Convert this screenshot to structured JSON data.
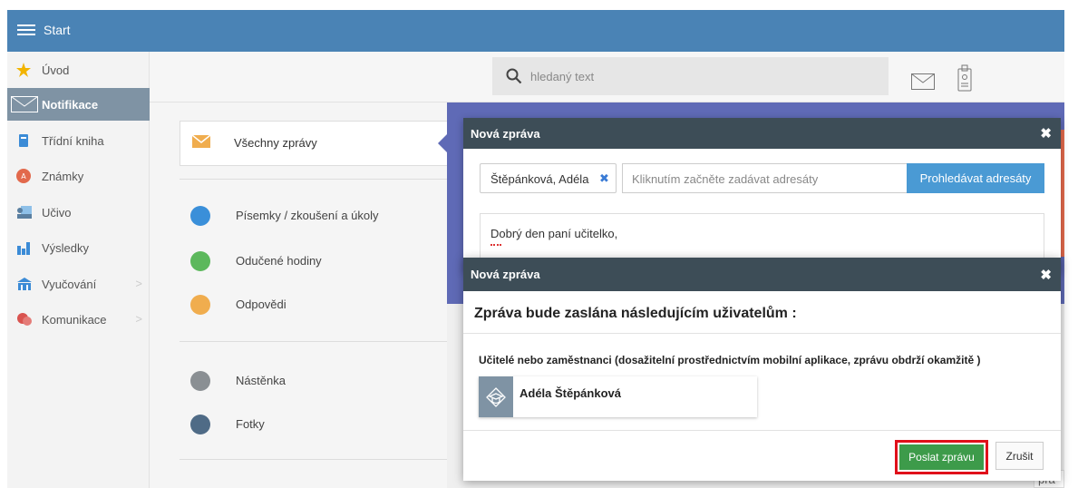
{
  "header": {
    "title": "Start"
  },
  "sidebar": {
    "items": [
      {
        "label": "Úvod",
        "icon": "star-icon",
        "color": "#f2b400"
      },
      {
        "label": "Notifikace",
        "icon": "envelope-icon",
        "color": "#ffffff"
      },
      {
        "label": "Třídní kniha",
        "icon": "book-icon",
        "color": "#3b8bd6"
      },
      {
        "label": "Známky",
        "icon": "grade-icon",
        "color": "#e2694c"
      },
      {
        "label": "Učivo",
        "icon": "teacher-icon",
        "color": "#5aa0d6"
      },
      {
        "label": "Výsledky",
        "icon": "bar-chart-icon",
        "color": "#3b8bd6"
      },
      {
        "label": "Vyučování",
        "icon": "building-icon",
        "color": "#3b8bd6"
      },
      {
        "label": "Komunikace",
        "icon": "chat-icon",
        "color": "#d9534f"
      }
    ]
  },
  "search": {
    "placeholder": "hledaný text"
  },
  "middle": {
    "all_messages": "Všechny zprávy",
    "items": [
      {
        "label": "Písemky / zkoušení a úkoly",
        "color": "#3a8fd9"
      },
      {
        "label": "Odučené hodiny",
        "color": "#5cb85c"
      },
      {
        "label": "Odpovědi",
        "color": "#f0ad4e"
      },
      {
        "label": "Nástěnka",
        "color": "#8a8f93"
      },
      {
        "label": "Fotky",
        "color": "#4f6b86"
      }
    ]
  },
  "modal1": {
    "title": "Nová zpráva",
    "recipient": "Štěpánková, Adéla",
    "recipient_placeholder": "Kliknutím začněte zadávat adresáty",
    "browse_button": "Prohledávat adresáty",
    "body_text": "Dobrý den paní učitelko,"
  },
  "modal2": {
    "title": "Nová zpráva",
    "heading": "Zpráva bude zaslána následujícím uživatelům :",
    "group_label": "Učitelé nebo zaměstnanci (dosažitelní prostřednictvím mobilní aplikace, zprávu obdrží okamžitě )",
    "user_name": "Adéla Štěpánková",
    "send_button": "Poslat zprávu",
    "cancel_button": "Zrušit"
  },
  "footer_fragment": "prá"
}
